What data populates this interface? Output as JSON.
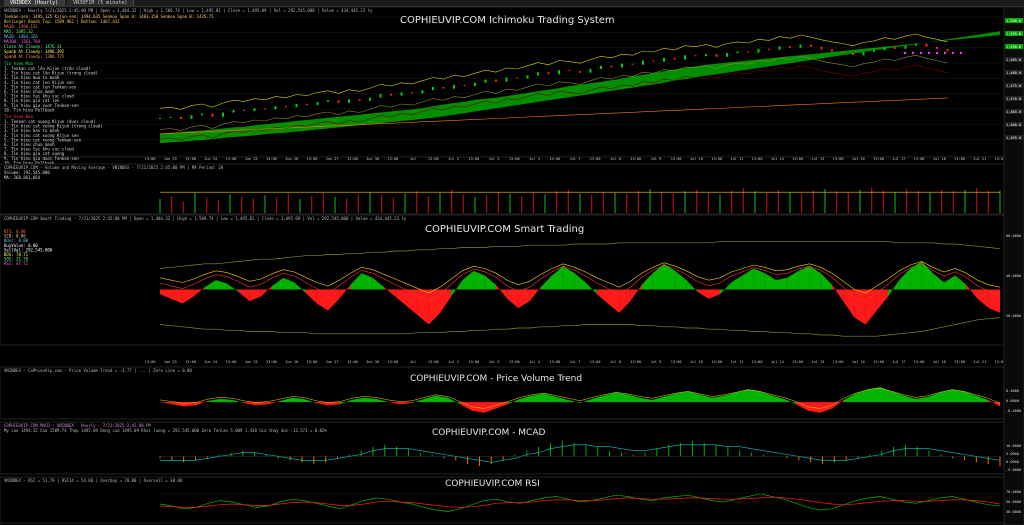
{
  "tabs": [
    {
      "label": "VNINDEX (Hourly)"
    },
    {
      "label": "VN30F1M (5 minute)"
    }
  ],
  "colors": {
    "bg": "#000000",
    "grid": "#1e1e1e",
    "up_fill": "#00b400",
    "down_fill": "#ff1a1a",
    "price": "#ffffff",
    "cloud": "#00a800",
    "yellow_line": "#d8d800",
    "olive_line": "#8a8a2a",
    "orange_line": "#ff7a00",
    "macd_line": "#00c8c8"
  },
  "time_labels": [
    "13:00",
    "Jun 23",
    "13:00",
    "Jun 24",
    "13:00",
    "Jun 25",
    "13:00",
    "Jun 26",
    "13:00",
    "Jun 27",
    "13:00",
    "Jun 30",
    "13:00",
    "Jul",
    "13:00",
    "Jul 2",
    "13:00",
    "Jul 3",
    "13:00",
    "Jul 4",
    "13:00",
    "Jul 7",
    "13:00",
    "Jul 8",
    "13:00",
    "Jul 9",
    "13:00",
    "Jul 10",
    "13:00",
    "Jul 11",
    "13:00",
    "Jul 14",
    "13:00",
    "Jul 15",
    "13:00",
    "Jul 16",
    "13:00",
    "Jul 17",
    "13:00",
    "Jul 18",
    "13:00",
    "Jul 21",
    "13:00"
  ],
  "panes": {
    "ichimoku": {
      "title": "COPHIEUVIP.COM Ichimoku Trading System",
      "header": "VNINDEX - Hourly  7/21/2025 2:45:00 PM | Open = 1,484.32 | High = 1,509.74 | Low = 1,495.81 | Close = 1,495.09 | Vol = 292,545,000 | Value = 434,445.23 ty",
      "indicators": [
        "Tenkan-sen: 1495.125   Kijun-sen: 1494.635   Senkou Span A: 1483.150   Senkou Span B: 1435.75",
        "Bollinger Bands Top: 1509.962 | Bottom: 1467.432",
        "MA10: 1496.132",
        "MA5: 1495.32",
        "MA20: 1484.326",
        "MA200: 1361.784",
        "Close At Cloudy: 1476.31",
        "Spanb At Cloudy: 1496.392",
        "SpanB At Cloudy: 1386.775"
      ],
      "tin_hieu_mua": [
        "1. Tenkan cat lên Kijun (trên cloud)",
        "2. Tin hieu cat lên Kijun (trong cloud)",
        "3. Tin hieu mua tu manh",
        "4. Tin hieu cat len Kijun sen",
        "5. Tin hieu cat len Tenkan-sen",
        "6. Tin hieu chua manh",
        "7. Tin hieu tai khu vuc cloud",
        "8. Tin hieu gia cat len",
        "9. Tin hieu gia vuot Tenkan-sen",
        "10. Tin hieu Pullback"
      ],
      "tin_hieu_ban": [
        "1. Tenkan cat xuong Kijun (duoi cloud)",
        "2. Tin hieu cat xuong Kijun (trong cloud)",
        "3. Tin hieu ban tu manh",
        "4. Tin hieu cat xuong Kijun sen",
        "5. Tin hieu cat xuong Tenkan-sen",
        "6. Tin hieu chua manh",
        "7. Tin hieu tai khu vuc cloud",
        "8. Tin hieu gia cat xuong",
        "9. Tin hieu gia duoi Tenkan-sen",
        "10. Tin hieu Pullback"
      ],
      "section_mua": "Tin hieu Mua",
      "section_ban": "Tin hieu Ban",
      "price_axis": [
        "1,500.0",
        "1,495.0",
        "1,490.0",
        "1,485.0",
        "1,480.0",
        "1,475.0",
        "1,470.0",
        "1,465.0",
        "1,460.0",
        "1,455.0"
      ]
    },
    "volume": {
      "header": "COPHIEUVIP.COM - Volume and Moving Average - VNINDEX - 7/21/2025 2:45:00 PM | MA Period: 20",
      "sub": "Volume: 292,545,000",
      "sub2": "MA: 268,861,664"
    },
    "smart": {
      "title": "COPHIEUVIP.COM Smart Trading",
      "header": "COPHIEUVIP.COM Smart Trading - 7/21/2025 2:45:00 PM | Open = 1,484.32 | High = 1,509.74 | Low = 1,495.81 | Close = 1,495.09 | Vol = 292,545,000 | Value = 434,445.23 ty",
      "readouts": [
        "BTS: 0.00",
        "SCB: 0.00",
        "BOsc: 0.00",
        "BuyValue: 0.00",
        "SellVal: 292,545,000",
        "BOS: 78.71",
        "SOS: 21.78",
        "RSI: 47.72"
      ],
      "right_axis": [
        "60.0000",
        "40.0000",
        "20.0000"
      ]
    },
    "pvt": {
      "title": "COPHIEUVIP.COM - Price Volume Trend",
      "header": "VNINDEX - CoPhieuVip.com - Price Volume Trend = -3.77 | ... | Zero Line = 0.00",
      "right_axis": [
        "0.4000",
        "0.0000",
        "-0.4000"
      ]
    },
    "macd": {
      "title": "COPHIEUVIP.COM - MCAD",
      "header": "COPHIEUVIP.COM MACD - VNINDEX - Hourly - 7/21/2025 2:45:00 PM",
      "sub": "My cuo 1494.32  Cao 1509.74  Thap 1495.09  Dong cua 1495.09  Khoi luong = 292,545,000   Zero Tenlan  5.009  1,430   Gia thay doi  -12.573 = 0.82%",
      "right_axis": [
        "10.0000",
        "5.0000",
        "0.0000",
        "-5.0000"
      ]
    },
    "rsi": {
      "title": "COPHIEUVIP.COM RSI",
      "header": "VNINDEX - RSI = 51.79 | RSI14 = 54.86 | Overbuy = 70.00 | Oversell = 30.00",
      "right_axis": [
        "70.0000",
        "50.0000",
        "30.0000"
      ]
    }
  },
  "chart_data": [
    {
      "type": "line",
      "name": "ichimoku",
      "title": "COPHIEUVIP.COM Ichimoku Trading System",
      "close": [
        1370,
        1372,
        1368,
        1375,
        1378,
        1372,
        1380,
        1385,
        1383,
        1388,
        1386,
        1392,
        1390,
        1396,
        1394,
        1400,
        1403,
        1398,
        1405,
        1402,
        1408,
        1415,
        1412,
        1418,
        1416,
        1422,
        1428,
        1425,
        1432,
        1430,
        1436,
        1442,
        1438,
        1446,
        1444,
        1450,
        1456,
        1452,
        1460,
        1458,
        1455,
        1462,
        1468,
        1465,
        1472,
        1470,
        1478,
        1476,
        1483,
        1480,
        1488,
        1486,
        1490,
        1485,
        1492,
        1495,
        1493,
        1500,
        1498,
        1505,
        1502,
        1508,
        1504,
        1499,
        1495,
        1492,
        1488,
        1494,
        1497,
        1503,
        1500,
        1506,
        1510,
        1504,
        1500,
        1495
      ],
      "cloud_top": [
        1340,
        1342,
        1343,
        1345,
        1346,
        1348,
        1350,
        1352,
        1353,
        1356,
        1358,
        1360,
        1362,
        1364,
        1366,
        1368,
        1370,
        1372,
        1374,
        1376,
        1378,
        1380,
        1382,
        1384,
        1386,
        1388,
        1392,
        1395,
        1398,
        1400,
        1404,
        1406,
        1408,
        1411,
        1414,
        1417,
        1420,
        1423,
        1426,
        1430,
        1432,
        1435,
        1438,
        1441,
        1444,
        1448,
        1451,
        1454,
        1458,
        1461,
        1464,
        1467,
        1470,
        1472,
        1474,
        1476,
        1478,
        1480,
        1482,
        1484,
        1486,
        1488,
        1490,
        1492,
        1494,
        1496,
        1498,
        1500,
        1502,
        1504,
        1506,
        1508,
        1510,
        1512,
        1514,
        1516,
        1518,
        1520,
        1522,
        1524,
        1526
      ],
      "cloud_bottom": [
        1322,
        1324,
        1325,
        1327,
        1328,
        1330,
        1332,
        1334,
        1335,
        1337,
        1339,
        1341,
        1342,
        1344,
        1346,
        1348,
        1350,
        1352,
        1354,
        1356,
        1358,
        1360,
        1362,
        1364,
        1366,
        1368,
        1370,
        1373,
        1376,
        1379,
        1382,
        1385,
        1388,
        1391,
        1394,
        1397,
        1400,
        1403,
        1406,
        1409,
        1412,
        1415,
        1418,
        1421,
        1424,
        1427,
        1430,
        1433,
        1436,
        1440,
        1443,
        1446,
        1449,
        1452,
        1455,
        1458,
        1461,
        1464,
        1467,
        1470,
        1473,
        1476,
        1479,
        1482,
        1485,
        1488,
        1491,
        1494,
        1497,
        1500,
        1503,
        1506,
        1509,
        1512,
        1515,
        1518,
        1521,
        1524,
        1527,
        1530,
        1533
      ],
      "ylim": [
        1300,
        1560
      ]
    },
    {
      "type": "bar",
      "name": "volume",
      "values": [
        180,
        220,
        150,
        260,
        200,
        170,
        240,
        210,
        190,
        230,
        200,
        250,
        180,
        220,
        260,
        210,
        190,
        240,
        270,
        230,
        200,
        250,
        280,
        220,
        260,
        300,
        240,
        210,
        230,
        270,
        250,
        220,
        260,
        240,
        280,
        300,
        250,
        230,
        270,
        260,
        240,
        290,
        310,
        270,
        250,
        280,
        300,
        260,
        240,
        290,
        320,
        280,
        260,
        300,
        270,
        250,
        290,
        310,
        280,
        260,
        300,
        330,
        290,
        270,
        310,
        290,
        260,
        300,
        280,
        300,
        320,
        290,
        292
      ],
      "ma": 268,
      "ylim": [
        0,
        400
      ]
    },
    {
      "type": "area",
      "name": "smart_trading",
      "values": [
        -4,
        -8,
        -12,
        -6,
        2,
        8,
        5,
        -2,
        -10,
        -6,
        3,
        10,
        6,
        -3,
        -12,
        -18,
        -8,
        4,
        14,
        10,
        2,
        -6,
        -14,
        -22,
        -30,
        -20,
        -6,
        8,
        16,
        12,
        4,
        -8,
        -16,
        -10,
        2,
        12,
        20,
        14,
        6,
        -4,
        -12,
        -20,
        -10,
        4,
        14,
        22,
        16,
        8,
        -2,
        -8,
        -4,
        6,
        12,
        18,
        14,
        8,
        10,
        16,
        20,
        14,
        4,
        -10,
        -24,
        -30,
        -18,
        -6,
        8,
        18,
        24,
        14,
        6,
        12,
        4,
        -8,
        -16,
        -20
      ],
      "upper": [
        18,
        19,
        20,
        21,
        22,
        22,
        23,
        24,
        25,
        26,
        26,
        27,
        28,
        29,
        29,
        30,
        30,
        31,
        31,
        32,
        32,
        33,
        33,
        34,
        34,
        35,
        35,
        36,
        36,
        36,
        37,
        37,
        37,
        38,
        38,
        38,
        38,
        39,
        39,
        39,
        39,
        40,
        40,
        40,
        40,
        40,
        40,
        40,
        40,
        40,
        41,
        41,
        41,
        41,
        41,
        41,
        41,
        41,
        41,
        41,
        41,
        41,
        41,
        41,
        41,
        41,
        40,
        40,
        40,
        40,
        39,
        39,
        38,
        37,
        36,
        35
      ],
      "lower": [
        -30,
        -31,
        -32,
        -33,
        -34,
        -34,
        -35,
        -35,
        -36,
        -36,
        -36,
        -37,
        -37,
        -37,
        -38,
        -38,
        -38,
        -38,
        -38,
        -38,
        -38,
        -38,
        -38,
        -37,
        -37,
        -37,
        -36,
        -36,
        -35,
        -35,
        -34,
        -34,
        -33,
        -33,
        -32,
        -32,
        -31,
        -31,
        -30,
        -30,
        -30,
        -30,
        -30,
        -31,
        -31,
        -32,
        -32,
        -33,
        -33,
        -34,
        -34,
        -35,
        -35,
        -36,
        -36,
        -37,
        -37,
        -38,
        -38,
        -39,
        -39,
        -40,
        -40,
        -40,
        -40,
        -39,
        -38,
        -37,
        -36,
        -34,
        -32,
        -30,
        -28,
        -26,
        -25,
        -24
      ],
      "ylim": [
        -45,
        45
      ]
    },
    {
      "type": "area",
      "name": "price_volume_trend",
      "values": [
        0,
        -2,
        -4,
        -3,
        1,
        3,
        2,
        -1,
        -3,
        -2,
        1,
        4,
        3,
        -1,
        -3,
        -2,
        2,
        4,
        3,
        0,
        -2,
        -1,
        3,
        6,
        4,
        -2,
        -8,
        -10,
        -6,
        -2,
        3,
        6,
        8,
        5,
        2,
        -1,
        3,
        6,
        9,
        7,
        4,
        2,
        5,
        8,
        10,
        7,
        4,
        6,
        9,
        12,
        10,
        6,
        3,
        -2,
        -8,
        -10,
        -6,
        2,
        8,
        12,
        14,
        10,
        6,
        3,
        5,
        9,
        12,
        10,
        6,
        2,
        -4
      ],
      "ylim": [
        -14,
        16
      ]
    },
    {
      "type": "bar",
      "name": "macd",
      "values": [
        -1,
        -2,
        -3,
        -2,
        -1,
        1,
        2,
        3,
        2,
        1,
        -1,
        -2,
        -3,
        -4,
        -3,
        -1,
        1,
        3,
        5,
        6,
        5,
        4,
        2,
        1,
        -1,
        -2,
        -4,
        -5,
        -4,
        -2,
        1,
        3,
        5,
        7,
        8,
        7,
        6,
        5,
        3,
        2,
        1,
        2,
        4,
        6,
        7,
        8,
        7,
        6,
        5,
        3,
        2,
        1,
        0,
        -1,
        -2,
        -3,
        -4,
        -3,
        -2,
        -1,
        1,
        3,
        5,
        6,
        5,
        3,
        1,
        -1,
        -2,
        -3,
        -4,
        -5
      ],
      "line": [
        -2,
        -2,
        -2,
        -2,
        -1,
        0,
        1,
        2,
        2,
        1,
        0,
        -1,
        -2,
        -2,
        -2,
        -1,
        0,
        1,
        3,
        4,
        4,
        4,
        3,
        2,
        1,
        0,
        -1,
        -2,
        -3,
        -2,
        -1,
        1,
        2,
        4,
        5,
        6,
        6,
        5,
        5,
        4,
        3,
        3,
        4,
        5,
        6,
        6,
        6,
        6,
        5,
        5,
        4,
        3,
        2,
        1,
        0,
        -1,
        -2,
        -2,
        -2,
        -1,
        0,
        1,
        3,
        4,
        4,
        4,
        3,
        2,
        1,
        0,
        -1,
        -2
      ],
      "ylim": [
        -8,
        10
      ]
    },
    {
      "type": "line",
      "name": "rsi",
      "values": [
        55,
        52,
        48,
        50,
        56,
        60,
        58,
        54,
        50,
        52,
        58,
        62,
        60,
        56,
        52,
        48,
        54,
        60,
        64,
        62,
        58,
        55,
        50,
        46,
        44,
        48,
        54,
        60,
        62,
        58,
        56,
        60,
        64,
        66,
        62,
        58,
        60,
        64,
        68,
        66,
        62,
        60,
        64,
        66,
        68,
        64,
        60,
        58,
        62,
        66,
        70,
        66,
        62,
        56,
        50,
        46,
        48,
        54,
        60,
        64,
        66,
        62,
        58,
        56,
        60,
        64,
        66,
        62,
        58,
        54,
        52
      ],
      "values2": [
        52,
        51,
        50,
        50,
        52,
        54,
        55,
        54,
        53,
        53,
        55,
        57,
        58,
        57,
        55,
        53,
        53,
        55,
        58,
        59,
        58,
        57,
        55,
        53,
        51,
        50,
        51,
        53,
        56,
        57,
        57,
        58,
        60,
        61,
        61,
        60,
        60,
        61,
        63,
        64,
        63,
        62,
        62,
        63,
        64,
        64,
        63,
        62,
        62,
        63,
        64,
        65,
        64,
        62,
        60,
        57,
        55,
        54,
        55,
        57,
        59,
        60,
        60,
        59,
        59,
        60,
        61,
        61,
        60,
        58,
        55
      ],
      "ylim": [
        30,
        80
      ]
    }
  ]
}
